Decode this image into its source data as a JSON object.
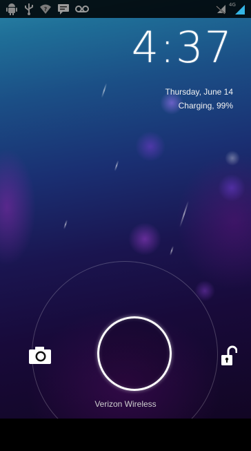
{
  "status_bar": {
    "left_icons": [
      "android-debug-icon",
      "usb-icon",
      "wifi-question-icon",
      "message-icon",
      "voicemail-icon"
    ],
    "right_icons": [
      "no-signal-sync-icon",
      "signal-4g-icon"
    ],
    "network_label": "4G",
    "accent_color": "#35b5e5"
  },
  "lockscreen": {
    "time": "4:37",
    "date": "Thursday, June 14",
    "charging": "Charging, 99%",
    "carrier": "Verizon Wireless",
    "left_target_icon": "camera-icon",
    "right_target_icon": "unlock-icon",
    "handle_icon": "unlock-ring-handle"
  },
  "colors": {
    "ring": "#ffffff",
    "text": "#f2f2f2",
    "status_bar_bg": "#000000"
  }
}
